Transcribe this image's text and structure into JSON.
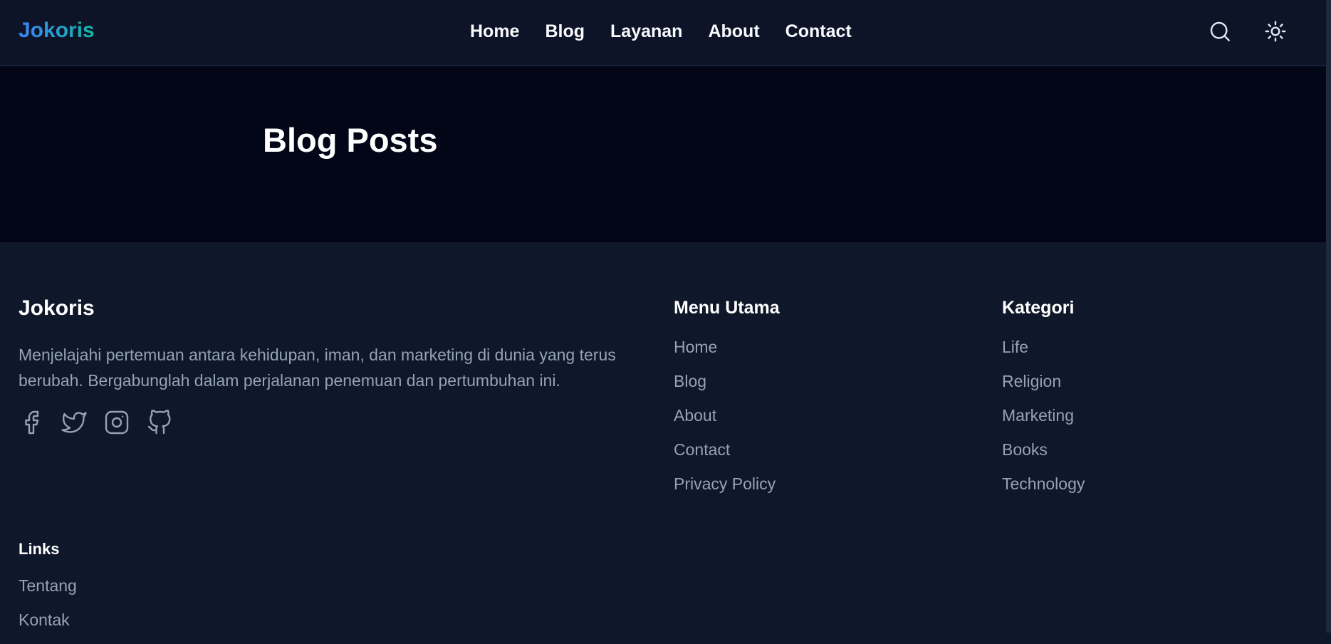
{
  "header": {
    "logo": "Jokoris",
    "nav": [
      "Home",
      "Blog",
      "Layanan",
      "About",
      "Contact"
    ],
    "search_icon": "search-icon",
    "theme_icon": "sun-icon"
  },
  "hero": {
    "title": "Blog Posts"
  },
  "footer": {
    "brand": {
      "title": "Jokoris",
      "description": "Menjelajahi pertemuan antara kehidupan, iman, dan marketing di dunia yang terus berubah. Bergabunglah dalam perjalanan penemuan dan pertumbuhan ini.",
      "social_icons": [
        "facebook-icon",
        "twitter-icon",
        "instagram-icon",
        "github-icon"
      ]
    },
    "menu": {
      "title": "Menu Utama",
      "items": [
        "Home",
        "Blog",
        "About",
        "Contact",
        "Privacy Policy"
      ]
    },
    "categories": {
      "title": "Kategori",
      "items": [
        "Life",
        "Religion",
        "Marketing",
        "Books",
        "Technology"
      ]
    },
    "links": {
      "title": "Links",
      "items": [
        "Tentang",
        "Kontak"
      ]
    }
  },
  "colors": {
    "header_bg": "#0d1427",
    "hero_bg": "#020617",
    "footer_bg": "#0f172a",
    "muted_text": "#94a3b8",
    "logo_gradient_start": "#3b82f6",
    "logo_gradient_end": "#14b8a6"
  }
}
